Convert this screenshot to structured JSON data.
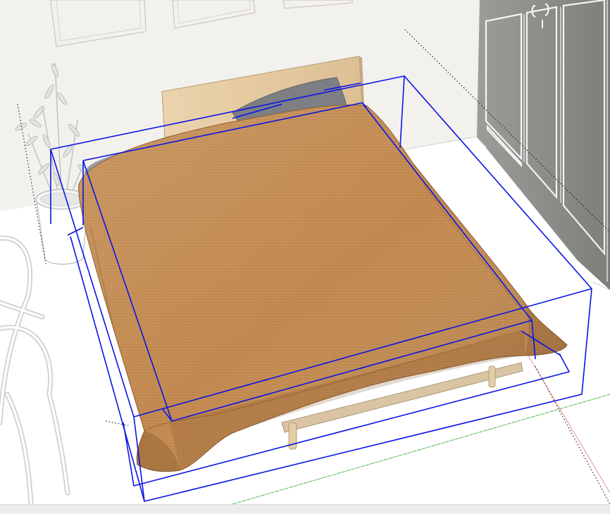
{
  "viewport": {
    "scene": "bedroom-3d-model",
    "selection": "bed-group",
    "colors": {
      "background": "#ffffff",
      "wall": "#f3f1ee",
      "floor": "#ffffff",
      "selection": "#0a14e6",
      "blanket": "#c0894f",
      "blanket_dark": "#a8723e",
      "headboard": "#e4c9a0",
      "pillow": "#7d7f84",
      "wardrobe": "#8a8d88",
      "axis_green": "#3cab3c",
      "axis_red": "#d23c3c",
      "status_bar": "#ececec"
    }
  }
}
